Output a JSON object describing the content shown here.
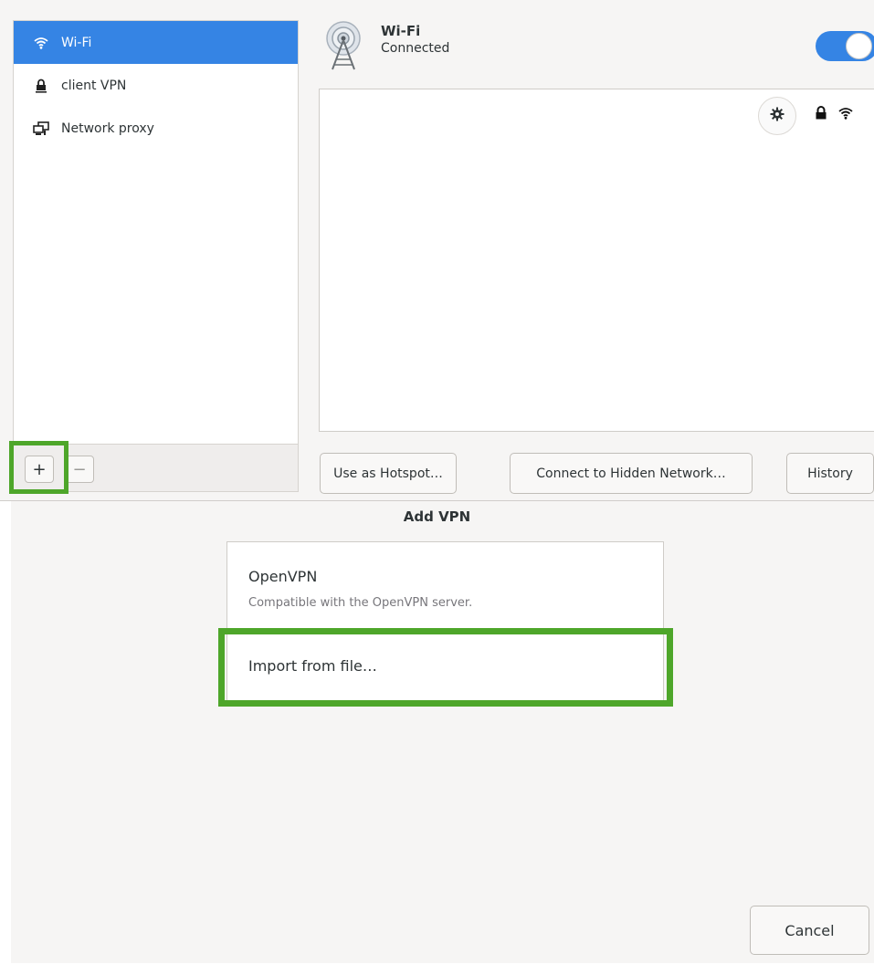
{
  "sidebar": {
    "items": [
      {
        "label": "Wi-Fi",
        "icon": "wifi-icon",
        "selected": true
      },
      {
        "label": "client VPN",
        "icon": "vpn-lock-icon",
        "selected": false
      },
      {
        "label": "Network proxy",
        "icon": "network-proxy-icon",
        "selected": false
      }
    ],
    "add_label": "+",
    "remove_label": "−"
  },
  "header": {
    "title": "Wi-Fi",
    "status": "Connected",
    "toggle_on": true
  },
  "actions": {
    "hotspot_label": "Use as Hotspot…",
    "hidden_label": "Connect to Hidden Network…",
    "history_label": "History"
  },
  "dialog": {
    "title": "Add VPN",
    "options": [
      {
        "title": "OpenVPN",
        "description": "Compatible with the OpenVPN server."
      },
      {
        "title": "Import from file…"
      }
    ],
    "cancel_label": "Cancel"
  },
  "colors": {
    "accent": "#3584e4",
    "highlight": "#4ea62a"
  }
}
